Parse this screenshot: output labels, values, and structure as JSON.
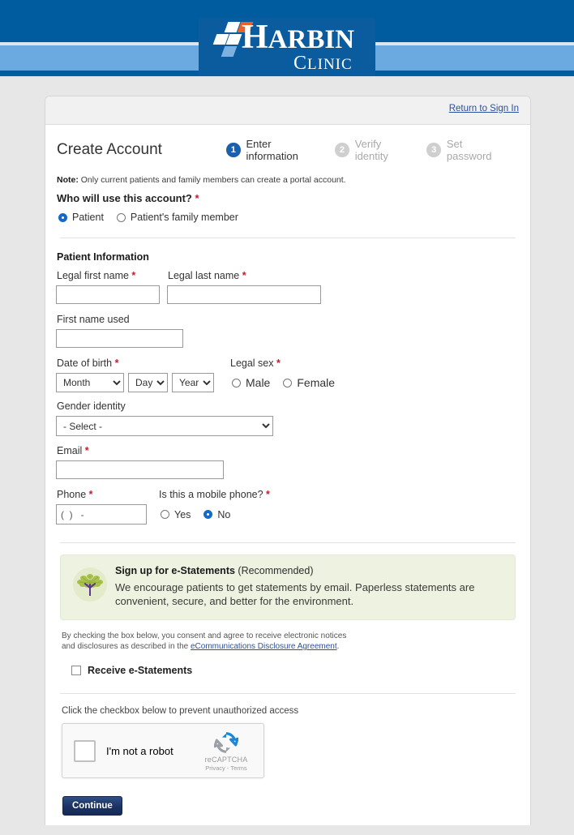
{
  "header": {
    "logo_primary": "HARBIN",
    "logo_secondary": "CLINIC"
  },
  "card": {
    "return_link": "Return to Sign In",
    "page_title": "Create Account",
    "steps": [
      {
        "num": "1",
        "label": "Enter information",
        "state": "active"
      },
      {
        "num": "2",
        "label": "Verify identity",
        "state": "inactive"
      },
      {
        "num": "3",
        "label": "Set password",
        "state": "inactive"
      }
    ],
    "note_prefix": "Note:",
    "note_text": " Only current patients and family members can create a portal account.",
    "who_question": "Who will use this account?",
    "who_options": [
      {
        "label": "Patient",
        "checked": true
      },
      {
        "label": "Patient's family member",
        "checked": false
      }
    ],
    "patient_information_heading": "Patient Information",
    "fields": {
      "legal_first_name_label": "Legal first name",
      "legal_first_name_value": "",
      "legal_last_name_label": "Legal last name",
      "legal_last_name_value": "",
      "first_name_used_label": "First name used",
      "first_name_used_value": "",
      "dob_label": "Date of birth",
      "dob_month": "Month",
      "dob_day": "Day",
      "dob_year": "Year",
      "legal_sex_label": "Legal sex",
      "legal_sex_options": [
        {
          "label": "Male",
          "checked": false
        },
        {
          "label": "Female",
          "checked": false
        }
      ],
      "gender_identity_label": "Gender identity",
      "gender_identity_value": "- Select -",
      "email_label": "Email",
      "email_value": "",
      "phone_label": "Phone",
      "phone_placeholder": "(  )   -",
      "mobile_question": "Is this a mobile phone?",
      "mobile_options": [
        {
          "label": "Yes",
          "checked": false
        },
        {
          "label": "No",
          "checked": true
        }
      ]
    },
    "estatements": {
      "title_bold": "Sign up for e-Statements",
      "title_rest": " (Recommended)",
      "body": "We encourage patients to get statements by email. Paperless statements are convenient, secure, and better for the environment.",
      "disclosure_line1": "By checking the box below, you consent and agree to receive electronic notices",
      "disclosure_line2_pre": "and disclosures as described in the ",
      "disclosure_link": "eCommunications Disclosure Agreement",
      "disclosure_line2_post": ".",
      "checkbox_label": "Receive e-Statements",
      "checkbox_checked": false
    },
    "captcha": {
      "hint": "Click the checkbox below to prevent unauthorized access",
      "label": "I'm not a robot",
      "brand": "reCAPTCHA",
      "terms": "Privacy - Terms",
      "checked": false
    },
    "continue_label": "Continue"
  },
  "colors": {
    "banner_dark": "#005b9f",
    "banner_mid": "#6aaae0",
    "logo_orange": "#e8632a",
    "accent_blue": "#1b5fad",
    "required_red": "#c01e2f",
    "estatement_bg": "#eef2e0",
    "button_navy": "#1b3263",
    "page_bg": "#e7e7e7"
  }
}
